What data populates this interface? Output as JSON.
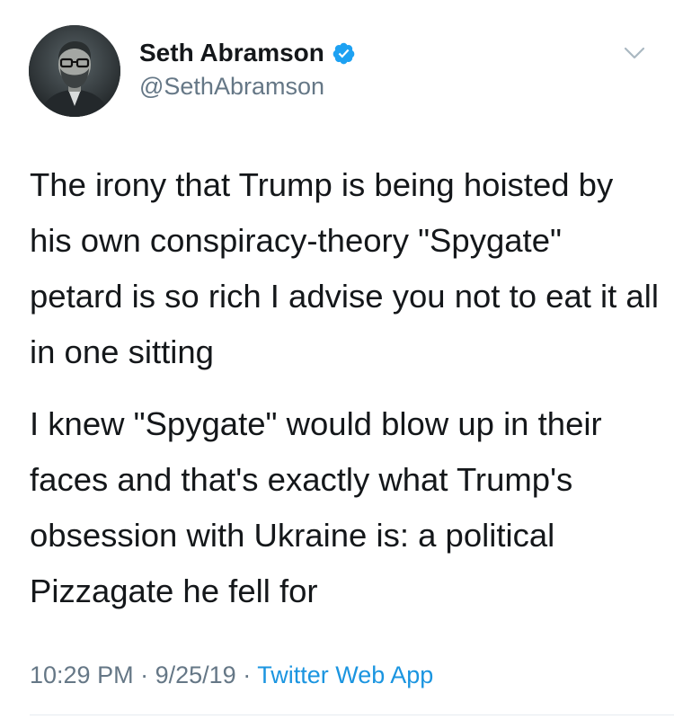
{
  "author": {
    "display_name": "Seth Abramson",
    "handle": "@SethAbramson",
    "verified": true
  },
  "tweet": {
    "paragraphs": [
      "The irony that Trump is being hoisted by his own conspiracy-theory \"Spygate\" petard is so rich I advise you not to eat it all in one sitting",
      "I knew \"Spygate\" would blow up in their faces and that's exactly what Trump's obsession with Ukraine is: a political Pizzagate he fell for"
    ]
  },
  "meta": {
    "time": "10:29 PM",
    "separator": "·",
    "date": "9/25/19",
    "source": "Twitter Web App"
  },
  "icons": {
    "verified": "verified-badge-icon",
    "menu": "chevron-down-icon"
  },
  "colors": {
    "text": "#14171a",
    "muted": "#657786",
    "link": "#1b95e0",
    "verified": "#1da1f2",
    "divider": "#e6ecf0"
  }
}
